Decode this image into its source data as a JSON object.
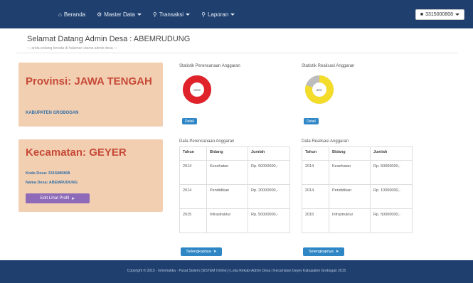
{
  "navbar": {
    "items": [
      {
        "icon": "home-icon",
        "glyph": "⌂",
        "label": "Beranda"
      },
      {
        "icon": "gear-icon",
        "glyph": "⚙",
        "label": "Master Data"
      },
      {
        "icon": "search-icon",
        "glyph": "⚲",
        "label": "Transaksi"
      },
      {
        "icon": "search-icon",
        "glyph": "⚲",
        "label": "Laporan"
      }
    ],
    "user_label": "3315000808"
  },
  "header": {
    "title": "Selamat Datang Admin Desa : ABEMRUDUNG",
    "subtitle": "— anda sedang berada di halaman utama admin desa —"
  },
  "province_panel": {
    "title": "Provinsi: JAWA TENGAH",
    "kabupaten": "KABUPATEN GROBOGAN"
  },
  "kecamatan_panel": {
    "title": "Kecamatan: GEYER",
    "kode_desa": "Kode Desa: 3315080808",
    "nama_desa": "Nama Desa: ABEMRUDUNG",
    "profile_button": "Edit Lihat Profil"
  },
  "stat_perencanaan": {
    "title": "Statistik Perencanaan Anggaran",
    "percent_label": "100%",
    "percent": 100,
    "badge": "Detail"
  },
  "stat_realisasi": {
    "title": "Statistik Realisasi Anggaran",
    "percent_label": "80%",
    "percent": 80,
    "badge": "Detail"
  },
  "table_perencanaan": {
    "title": "Data Perencanaan Anggaran",
    "headers": [
      "Tahun",
      "Bidang",
      "Jumlah"
    ],
    "rows": [
      [
        "2014",
        "Kesehatan",
        "Rp. 50000000,-"
      ],
      [
        "2014",
        "Pendidikan",
        "Rp. 20000000,-"
      ],
      [
        "2015",
        "Infrastruktur",
        "Rp. 50000000,-"
      ]
    ],
    "more_button": "Selengkapnya"
  },
  "table_realisasi": {
    "title": "Data Realisasi Anggaran",
    "headers": [
      "Tahun",
      "Bidang",
      "Jumlah"
    ],
    "rows": [
      [
        "2014",
        "Kesehatan",
        "Rp. 50000000,-"
      ],
      [
        "2014",
        "Pendidikan",
        "Rp. 10000000,-"
      ],
      [
        "2015",
        "Infrastruktur",
        "Rp. 50000000,-"
      ]
    ],
    "more_button": "Selengkapnya"
  },
  "footer": {
    "text": "Copyright © 2015 · Informatika · Pusat Sistem (SISTEM Online) | Loka Rekabi Admin Desa | Kecamatan Geyer Kabupaten Grobogan 2015"
  },
  "colors": {
    "navbar": "#1f3f6e",
    "panel": "#f3cfb2",
    "panel_title": "#c64a37",
    "donut_red": "#e0222b",
    "donut_yellow": "#f4dc2a",
    "donut_gray": "#bdbdbd",
    "accent": "#2f86c5",
    "profile_button": "#8e6bb8"
  }
}
